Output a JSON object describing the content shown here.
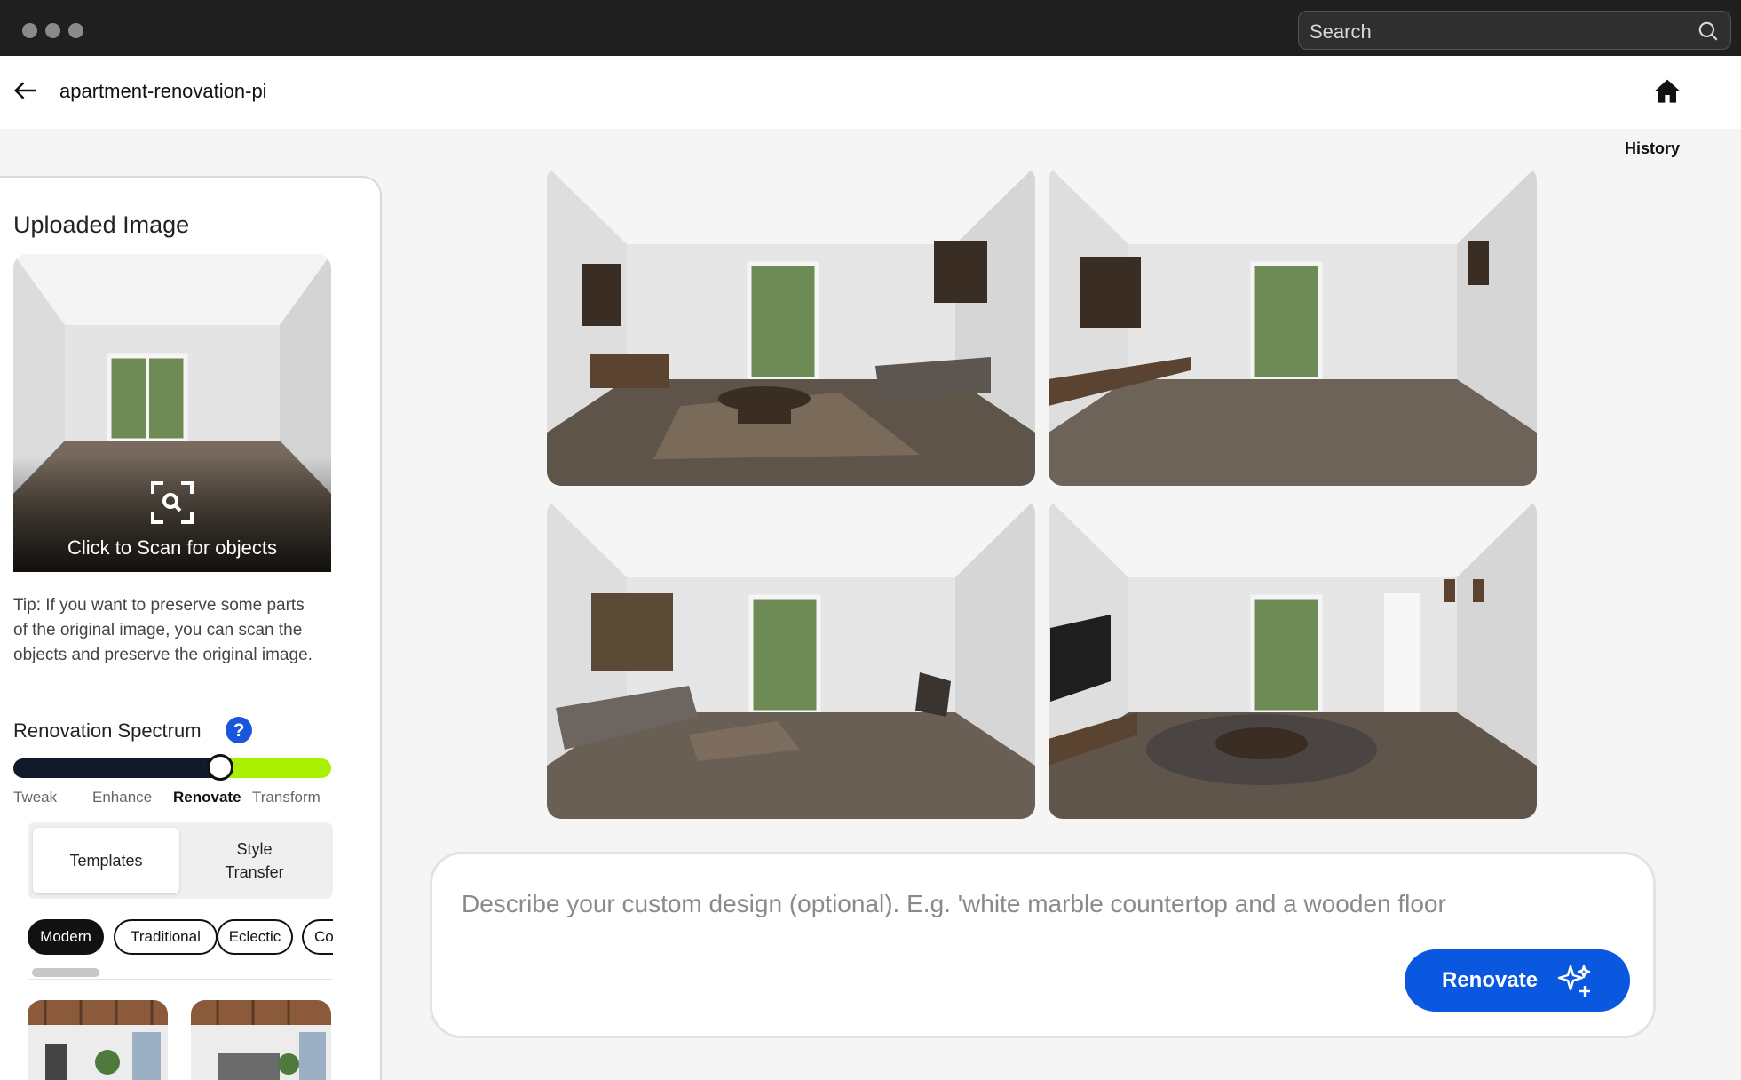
{
  "window": {
    "search_placeholder": "Search"
  },
  "header": {
    "project_name": "apartment-renovation-pi"
  },
  "history_label": "History",
  "sidebar": {
    "uploaded_title": "Uploaded Image",
    "scan_label": "Click to Scan for objects",
    "tip": "Tip: If you want to preserve some parts of the original image, you can scan the objects and preserve the original image.",
    "spectrum_title": "Renovation Spectrum",
    "spectrum_value": 0.65,
    "spectrum_labels": [
      "Tweak",
      "Enhance",
      "Renovate",
      "Transform"
    ],
    "spectrum_selected": "Renovate",
    "mode_tabs": [
      "Templates",
      "Style Transfer"
    ],
    "mode_selected": "Templates",
    "style_chips": [
      "Modern",
      "Traditional",
      "Eclectic",
      "Co"
    ],
    "style_selected": "Modern"
  },
  "prompt": {
    "placeholder": "Describe your custom design (optional). E.g. 'white marble countertop and a wooden floor",
    "value": "",
    "renovate_label": "Renovate"
  },
  "colors": {
    "accent": "#0a57e0",
    "spectrum_dark": "#101a2b",
    "spectrum_lime": "#a8f000"
  }
}
